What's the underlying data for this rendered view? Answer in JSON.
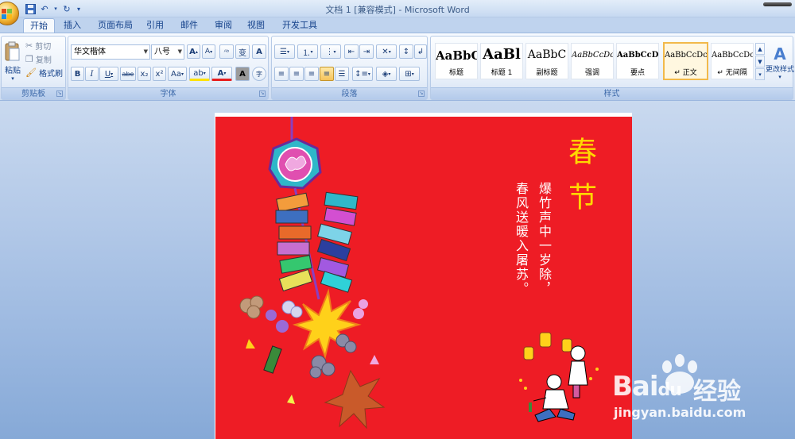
{
  "window": {
    "title": "文档 1 [兼容模式] - Microsoft Word"
  },
  "quick_access": {
    "save_icon": "save-icon",
    "undo_icon": "undo-icon",
    "redo_icon": "redo-icon"
  },
  "tabs": [
    {
      "label": "开始",
      "active": true
    },
    {
      "label": "插入"
    },
    {
      "label": "页面布局"
    },
    {
      "label": "引用"
    },
    {
      "label": "邮件"
    },
    {
      "label": "审阅"
    },
    {
      "label": "视图"
    },
    {
      "label": "开发工具"
    }
  ],
  "clipboard": {
    "paste": "粘贴",
    "cut": "剪切",
    "copy": "复制",
    "format_painter": "格式刷",
    "label": "剪贴板"
  },
  "font": {
    "name": "华文楷体",
    "size": "八号",
    "grow": "A",
    "shrink": "A",
    "phonetic": "变",
    "border_char": "A",
    "bold": "B",
    "italic": "I",
    "underline": "U",
    "strike": "abe",
    "subscript": "x₂",
    "superscript": "x²",
    "change_case": "Aa",
    "highlight": "ab",
    "font_color": "A",
    "char_shading": "A",
    "enclose": "字",
    "label": "字体"
  },
  "paragraph": {
    "label": "段落"
  },
  "styles": {
    "items": [
      {
        "sample": "AaBbC",
        "name": "标题"
      },
      {
        "sample": "AaBl",
        "name": "标题 1"
      },
      {
        "sample": "AaBbC",
        "name": "副标题"
      },
      {
        "sample": "AaBbCcDc",
        "name": "强调"
      },
      {
        "sample": "AaBbCcD",
        "name": "要点"
      },
      {
        "sample": "AaBbCcDc",
        "name": "↵ 正文",
        "selected": true
      },
      {
        "sample": "AaBbCcDc",
        "name": "↵ 无间隔"
      }
    ],
    "change_styles": "更改样式",
    "label": "样式"
  },
  "document": {
    "title_char1": "春",
    "title_char2": "节",
    "poem_line1": "爆竹声中一岁除，",
    "poem_line2": "春风送暖入屠苏。"
  },
  "watermark": {
    "brand": "Bai",
    "brand_suffix": "du",
    "jingyan": "经验",
    "url": "jingyan.baidu.com"
  },
  "colors": {
    "card_background": "#ee1c25",
    "title_color": "#ffd800",
    "poem_color": "#ffffff"
  }
}
